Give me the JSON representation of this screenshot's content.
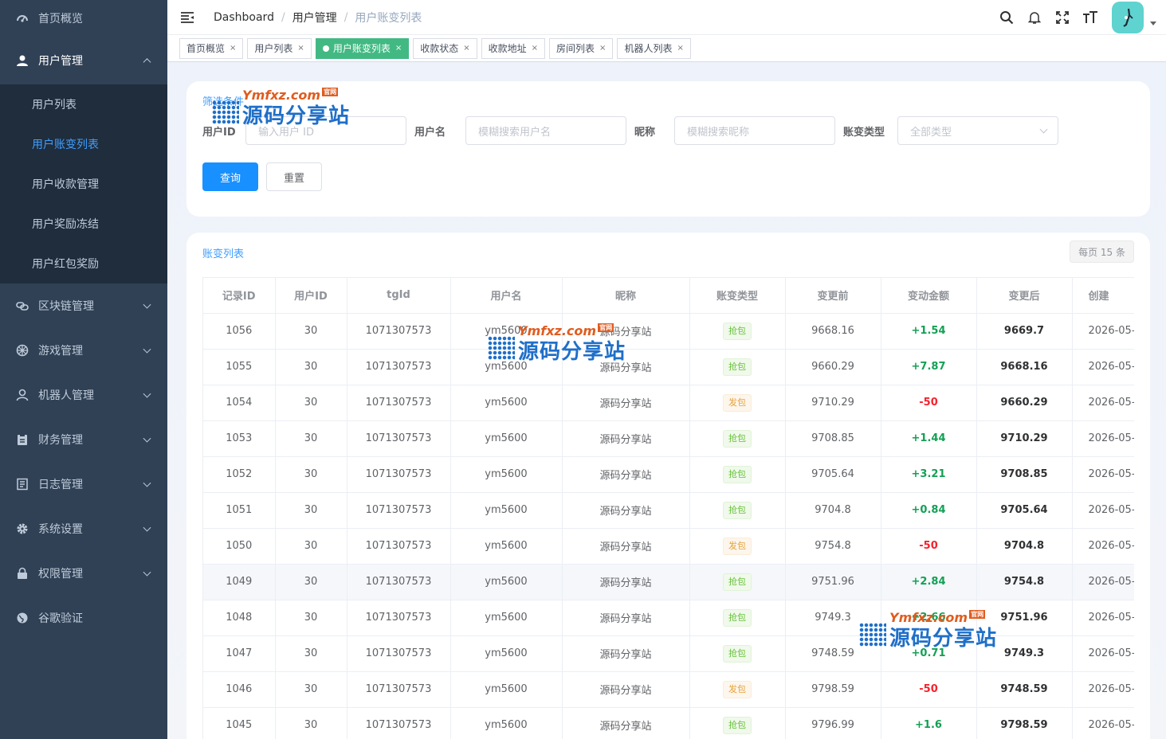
{
  "sidebar": {
    "items": [
      {
        "label": "首页概览",
        "icon": "dashboard-icon"
      },
      {
        "label": "用户管理",
        "icon": "user-icon",
        "open": true
      },
      {
        "label": "区块链管理",
        "icon": "chain-icon"
      },
      {
        "label": "游戏管理",
        "icon": "game-icon"
      },
      {
        "label": "机器人管理",
        "icon": "robot-icon"
      },
      {
        "label": "财务管理",
        "icon": "finance-icon"
      },
      {
        "label": "日志管理",
        "icon": "log-icon"
      },
      {
        "label": "系统设置",
        "icon": "gear-icon"
      },
      {
        "label": "权限管理",
        "icon": "lock-icon"
      },
      {
        "label": "谷歌验证",
        "icon": "globe-icon"
      }
    ],
    "submenu": [
      {
        "label": "用户列表"
      },
      {
        "label": "用户账变列表",
        "active": true
      },
      {
        "label": "用户收款管理"
      },
      {
        "label": "用户奖励冻结"
      },
      {
        "label": "用户红包奖励"
      }
    ]
  },
  "breadcrumb": [
    "Dashboard",
    "用户管理",
    "用户账变列表"
  ],
  "tags": [
    {
      "label": "首页概览"
    },
    {
      "label": "用户列表"
    },
    {
      "label": "用户账变列表",
      "active": true
    },
    {
      "label": "收款状态"
    },
    {
      "label": "收款地址"
    },
    {
      "label": "房间列表"
    },
    {
      "label": "机器人列表"
    }
  ],
  "filter": {
    "title": "筛选条件",
    "fields": [
      {
        "label": "用户ID",
        "placeholder": "输入用户 ID"
      },
      {
        "label": "用户名",
        "placeholder": "模糊搜索用户名"
      },
      {
        "label": "昵称",
        "placeholder": "模糊搜索昵称"
      },
      {
        "label": "账变类型",
        "placeholder": "全部类型"
      }
    ],
    "search_label": "查询",
    "reset_label": "重置"
  },
  "table": {
    "title": "账变列表",
    "page_size": "每页 15 条",
    "columns": [
      "记录ID",
      "用户ID",
      "tgId",
      "用户名",
      "昵称",
      "账变类型",
      "变更前",
      "变动金额",
      "变更后",
      "创建"
    ],
    "rows": [
      {
        "id": "1056",
        "uid": "30",
        "tgid": "1071307573",
        "username": "ym5600",
        "nickname": "源码分享站",
        "type": "抢包",
        "before": "9668.16",
        "amount": "+1.54",
        "after": "9669.7",
        "created": "2026-05-"
      },
      {
        "id": "1055",
        "uid": "30",
        "tgid": "1071307573",
        "username": "ym5600",
        "nickname": "源码分享站",
        "type": "抢包",
        "before": "9660.29",
        "amount": "+7.87",
        "after": "9668.16",
        "created": "2026-05-"
      },
      {
        "id": "1054",
        "uid": "30",
        "tgid": "1071307573",
        "username": "ym5600",
        "nickname": "源码分享站",
        "type": "发包",
        "before": "9710.29",
        "amount": "-50",
        "after": "9660.29",
        "created": "2026-05-"
      },
      {
        "id": "1053",
        "uid": "30",
        "tgid": "1071307573",
        "username": "ym5600",
        "nickname": "源码分享站",
        "type": "抢包",
        "before": "9708.85",
        "amount": "+1.44",
        "after": "9710.29",
        "created": "2026-05-"
      },
      {
        "id": "1052",
        "uid": "30",
        "tgid": "1071307573",
        "username": "ym5600",
        "nickname": "源码分享站",
        "type": "抢包",
        "before": "9705.64",
        "amount": "+3.21",
        "after": "9708.85",
        "created": "2026-05-"
      },
      {
        "id": "1051",
        "uid": "30",
        "tgid": "1071307573",
        "username": "ym5600",
        "nickname": "源码分享站",
        "type": "抢包",
        "before": "9704.8",
        "amount": "+0.84",
        "after": "9705.64",
        "created": "2026-05-"
      },
      {
        "id": "1050",
        "uid": "30",
        "tgid": "1071307573",
        "username": "ym5600",
        "nickname": "源码分享站",
        "type": "发包",
        "before": "9754.8",
        "amount": "-50",
        "after": "9704.8",
        "created": "2026-05-"
      },
      {
        "id": "1049",
        "uid": "30",
        "tgid": "1071307573",
        "username": "ym5600",
        "nickname": "源码分享站",
        "type": "抢包",
        "before": "9751.96",
        "amount": "+2.84",
        "after": "9754.8",
        "created": "2026-05-",
        "hover": true
      },
      {
        "id": "1048",
        "uid": "30",
        "tgid": "1071307573",
        "username": "ym5600",
        "nickname": "源码分享站",
        "type": "抢包",
        "before": "9749.3",
        "amount": "+2.66",
        "after": "9751.96",
        "created": "2026-05-"
      },
      {
        "id": "1047",
        "uid": "30",
        "tgid": "1071307573",
        "username": "ym5600",
        "nickname": "源码分享站",
        "type": "抢包",
        "before": "9748.59",
        "amount": "+0.71",
        "after": "9749.3",
        "created": "2026-05-"
      },
      {
        "id": "1046",
        "uid": "30",
        "tgid": "1071307573",
        "username": "ym5600",
        "nickname": "源码分享站",
        "type": "发包",
        "before": "9798.59",
        "amount": "-50",
        "after": "9748.59",
        "created": "2026-05-"
      },
      {
        "id": "1045",
        "uid": "30",
        "tgid": "1071307573",
        "username": "ym5600",
        "nickname": "源码分享站",
        "type": "抢包",
        "before": "9796.99",
        "amount": "+1.6",
        "after": "9798.59",
        "created": "2026-05-"
      }
    ]
  },
  "watermark": {
    "top": "Ymfxz.com",
    "badge": "官网",
    "text": "源码分享站"
  },
  "colors": {
    "sidebar_bg": "#304156",
    "active_menu": "#409eff",
    "active_tag": "#42b983",
    "positive": "#13a054",
    "negative": "#f5222d",
    "primary": "#1890ff"
  }
}
